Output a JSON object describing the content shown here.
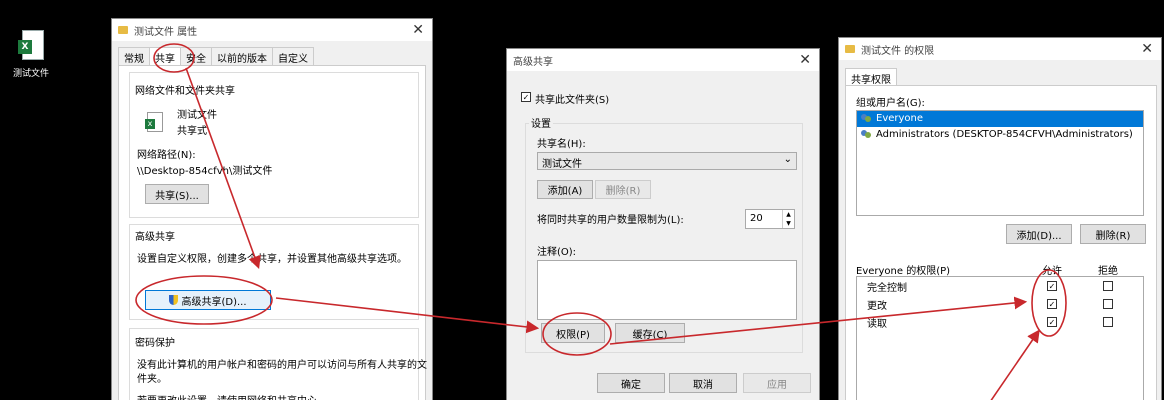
{
  "desktop": {
    "icon_label": "测试文件"
  },
  "props": {
    "title": "测试文件 属性",
    "tabs": [
      "常规",
      "共享",
      "安全",
      "以前的版本",
      "自定义"
    ],
    "net_section": "网络文件和文件夹共享",
    "file_name": "测试文件",
    "file_state": "共享式",
    "net_path_label": "网络路径(N):",
    "net_path": "\\\\Desktop-854cfvh\\测试文件",
    "share_button": "共享(S)...",
    "adv_section": "高级共享",
    "adv_desc": "设置自定义权限，创建多个共享，并设置其他高级共享选项。",
    "adv_button": "高级共享(D)...",
    "pwd_section": "密码保护",
    "pwd_desc_1": "没有此计算机的用户帐户和密码的用户可以访问与所有人共享的文",
    "pwd_desc_2": "件夹。",
    "pwd_desc_3": "若要更改此设置，请使用网络和共享中心。"
  },
  "adv": {
    "title": "高级共享",
    "share_check": "共享此文件夹(S)",
    "settings": "设置",
    "share_name_label": "共享名(H):",
    "share_name": "测试文件",
    "add_button": "添加(A)",
    "remove_button": "删除(R)",
    "limit_label": "将同时共享的用户数量限制为(L):",
    "limit_value": "20",
    "comment_label": "注释(O):",
    "perm_button": "权限(P)",
    "cache_button": "缓存(C)",
    "ok_button": "确定",
    "cancel_button": "取消",
    "apply_button": "应用"
  },
  "perm": {
    "title": "测试文件 的权限",
    "tab": "共享权限",
    "group_label": "组或用户名(G):",
    "users": [
      "Everyone",
      "Administrators (DESKTOP-854CFVH\\Administrators)"
    ],
    "add_button": "添加(D)...",
    "remove_button": "删除(R)",
    "perm_for": "Everyone 的权限(P)",
    "allow": "允许",
    "deny": "拒绝",
    "rows": [
      {
        "name": "完全控制",
        "allow": true,
        "deny": false
      },
      {
        "name": "更改",
        "allow": true,
        "deny": false
      },
      {
        "name": "读取",
        "allow": true,
        "deny": false
      }
    ]
  },
  "colors": {
    "annotation": "#c8282c",
    "selection": "#0078d7"
  }
}
